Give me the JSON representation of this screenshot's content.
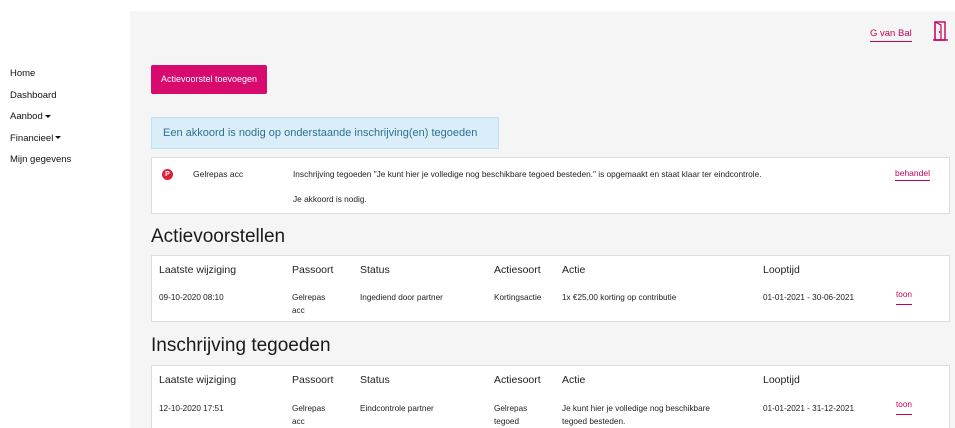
{
  "sidebar": {
    "items": [
      {
        "label": "Home"
      },
      {
        "label": "Dashboard"
      },
      {
        "label": "Aanbod"
      },
      {
        "label": "Financieel"
      },
      {
        "label": "Mijn gegevens"
      }
    ]
  },
  "header": {
    "user_name": "G van Bal",
    "logout_icon": "door-exit-icon"
  },
  "actions": {
    "add_button": "Actievoorstel toevoegen"
  },
  "alert": {
    "text": "Een akkoord is nodig op onderstaande inschrijving(en) tegoeden"
  },
  "approval": {
    "badge": "P",
    "passport": "Gelrepas acc",
    "message": "Inschrijving tegoeden \"Je kunt hier je volledige nog beschikbare tegoed besteden.\" is opgemaakt en staat klaar ter eindcontrole.",
    "note": "Je akkoord is nodig.",
    "link": "behandel"
  },
  "columns": {
    "last_change": "Laatste wijziging",
    "passport": "Passoort",
    "status": "Status",
    "action_type": "Actiesoort",
    "action": "Actie",
    "period": "Looptijd"
  },
  "actievoorstellen": {
    "title": "Actievoorstellen",
    "rows": [
      {
        "last_change": "09-10-2020 08:10",
        "passport_line1": "Gelrepas",
        "passport_line2": "acc",
        "status": "Ingediend door partner",
        "action_type": "Kortingsactie",
        "action": "1x €25,00 korting op contributie",
        "period": "01-01-2021 - 30-06-2021",
        "link": "toon"
      }
    ]
  },
  "inschrijving": {
    "title": "Inschrijving tegoeden",
    "rows": [
      {
        "last_change": "12-10-2020 17:51",
        "passport_line1": "Gelrepas",
        "passport_line2": "acc",
        "status": "Eindcontrole partner",
        "action_type_line1": "Gelrepas",
        "action_type_line2": "tegoed",
        "action_line1": "Je kunt hier je volledige nog beschikbare",
        "action_line2": "tegoed besteden.",
        "period": "01-01-2021 - 31-12-2021",
        "link": "toon"
      }
    ]
  }
}
